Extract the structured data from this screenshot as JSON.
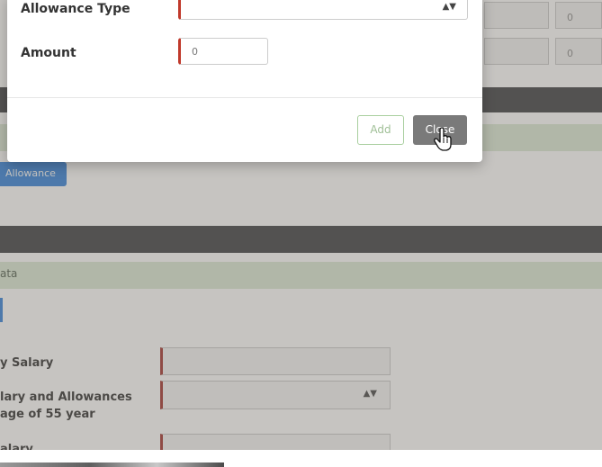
{
  "modal": {
    "allowance_type_label": "Allowance Type",
    "allowance_type_value": "",
    "amount_label": "Amount",
    "amount_value": "0",
    "add_label": "Add",
    "close_label": "Close"
  },
  "background": {
    "right_cells": [
      "0",
      "0"
    ],
    "add_allowance_button": "Allowance",
    "section_title": "ata",
    "fields": [
      {
        "label": "y Salary",
        "value": ""
      },
      {
        "label": "lary and Allowances\n age of 55 year",
        "value": ""
      },
      {
        "label": "alary",
        "value": ""
      }
    ]
  },
  "colors": {
    "required_marker": "#c0392b",
    "close_button": "#7a7a7a",
    "add_button_border": "#a9cf9f",
    "accent_blue": "#2f7fd9"
  }
}
